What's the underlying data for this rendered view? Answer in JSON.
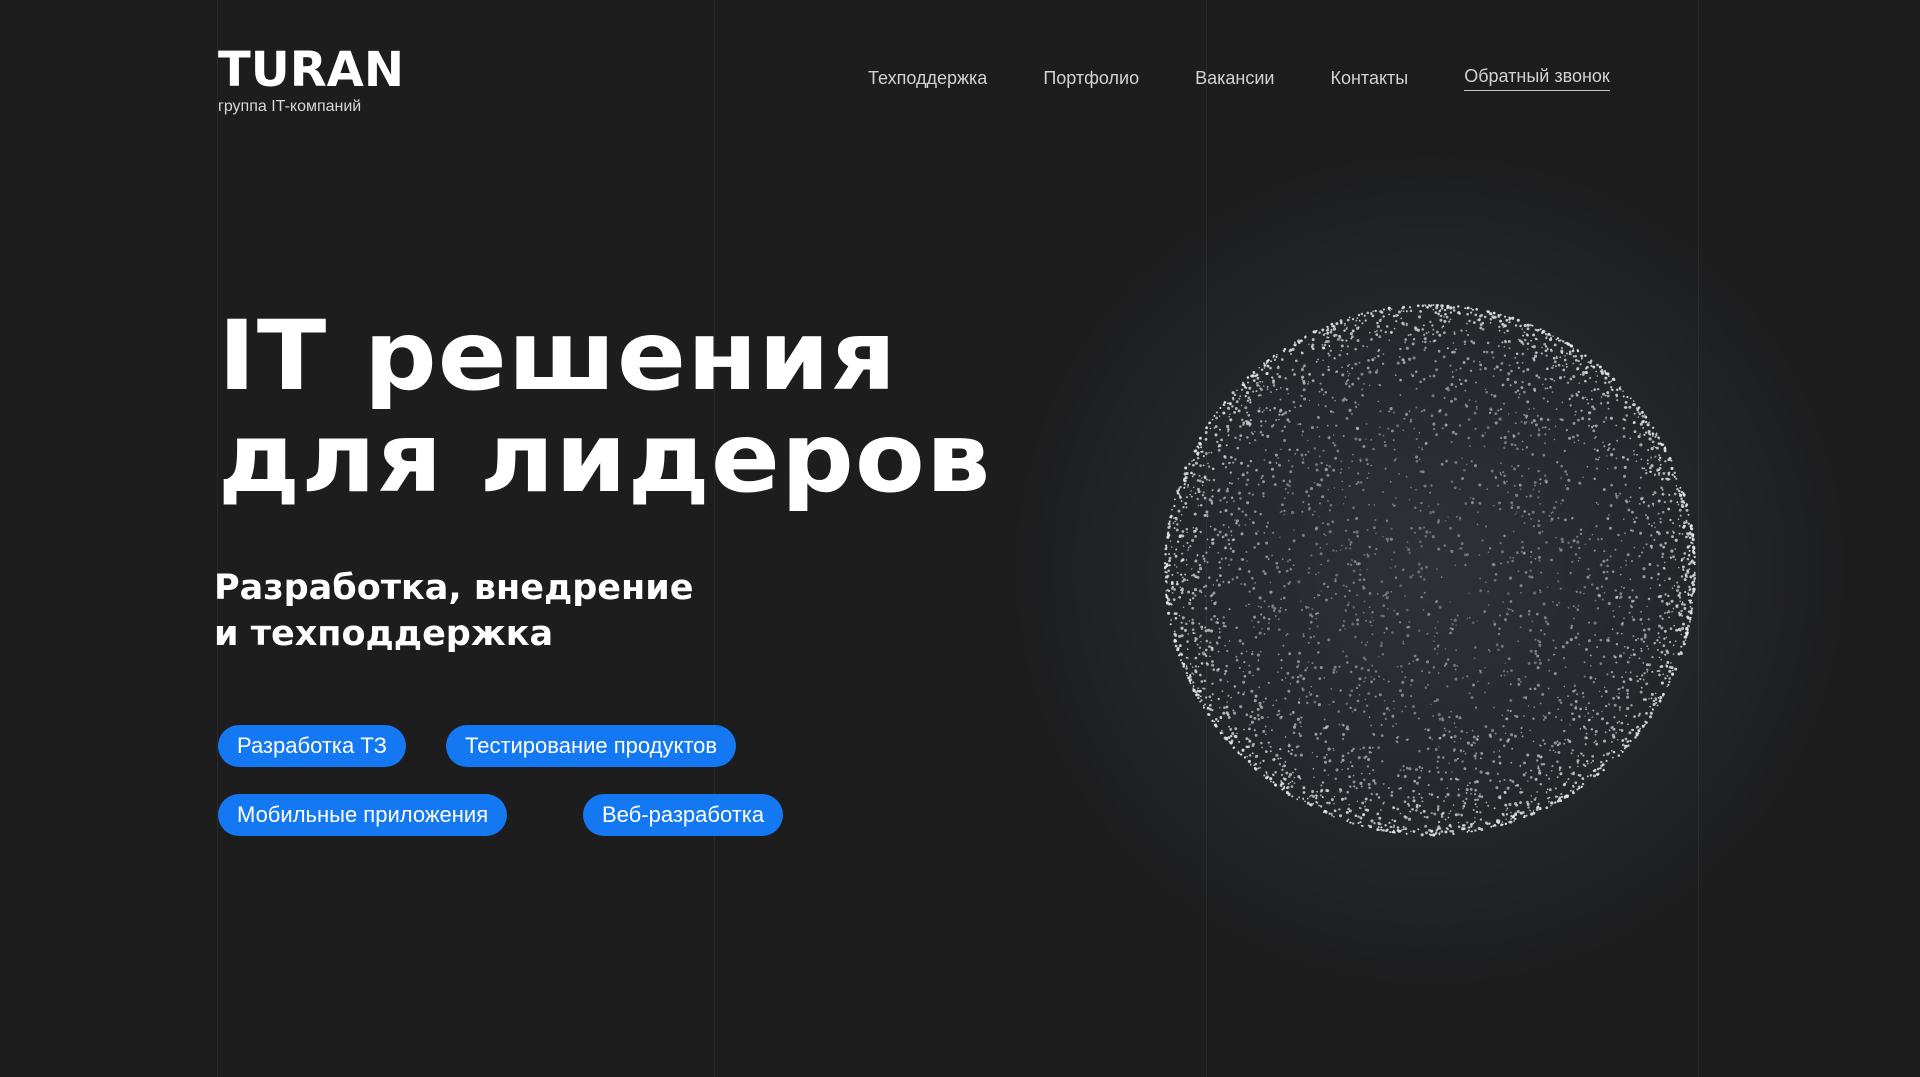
{
  "brand": {
    "name": "TURAN",
    "tagline": "группа IT-компаний"
  },
  "nav": {
    "items": [
      {
        "label": "Техподдержка"
      },
      {
        "label": "Портфолио"
      },
      {
        "label": "Вакансии"
      },
      {
        "label": "Контакты"
      },
      {
        "label": "Обратный звонок"
      }
    ]
  },
  "hero": {
    "title_line1": "IT решения",
    "title_line2": "для лидеров",
    "subtitle_line1": "Разработка, внедрение",
    "subtitle_line2": "и техподдержка"
  },
  "tags": [
    {
      "label": "Разработка ТЗ"
    },
    {
      "label": "Тестирование продуктов"
    },
    {
      "label": "Мобильные приложения"
    },
    {
      "label": "Веб-разработка"
    }
  ],
  "colors": {
    "background": "#1d1d1e",
    "accent": "#1378f2",
    "text": "#ffffff"
  },
  "decor": {
    "sphere_icon": "particle-sphere-icon"
  }
}
